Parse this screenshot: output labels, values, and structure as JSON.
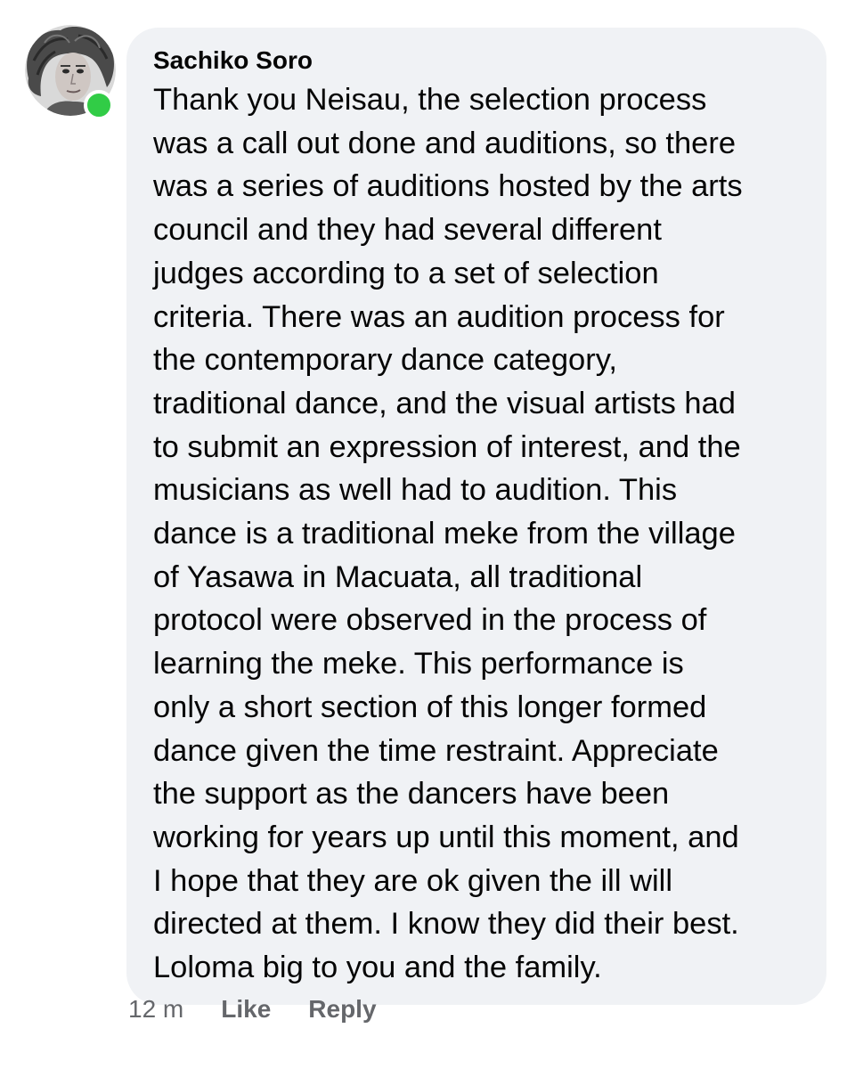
{
  "comment": {
    "author": "Sachiko Soro",
    "online": true,
    "colors": {
      "bubble": "#f0f2f5",
      "presence": "#31cc46",
      "meta_text": "#65676b",
      "body_text": "#050505"
    },
    "body_lines": [
      "Thank you Neisau, the selection process",
      "was a call out done and auditions, so there",
      "was a series of auditions hosted by the arts",
      "council and they had several different",
      "judges according to a set of selection",
      "criteria. There was an audition process for",
      "the contemporary dance category,",
      "traditional dance, and the visual artists had",
      "to submit an expression of interest, and the",
      "musicians as well had to audition. This",
      "dance is a traditional meke from the village",
      "of Yasawa in Macuata, all traditional",
      "protocol were observed in the process of",
      "learning the meke. This performance is",
      "only a short section of this longer formed",
      "dance given the time restraint. Appreciate",
      "the support as the dancers have been",
      "working for years up until this moment, and",
      "I hope that they are ok given the ill will",
      "directed at them. I know they did their best.",
      "Loloma big to you and the family."
    ],
    "timestamp": "12 m",
    "like_label": "Like",
    "reply_label": "Reply"
  }
}
